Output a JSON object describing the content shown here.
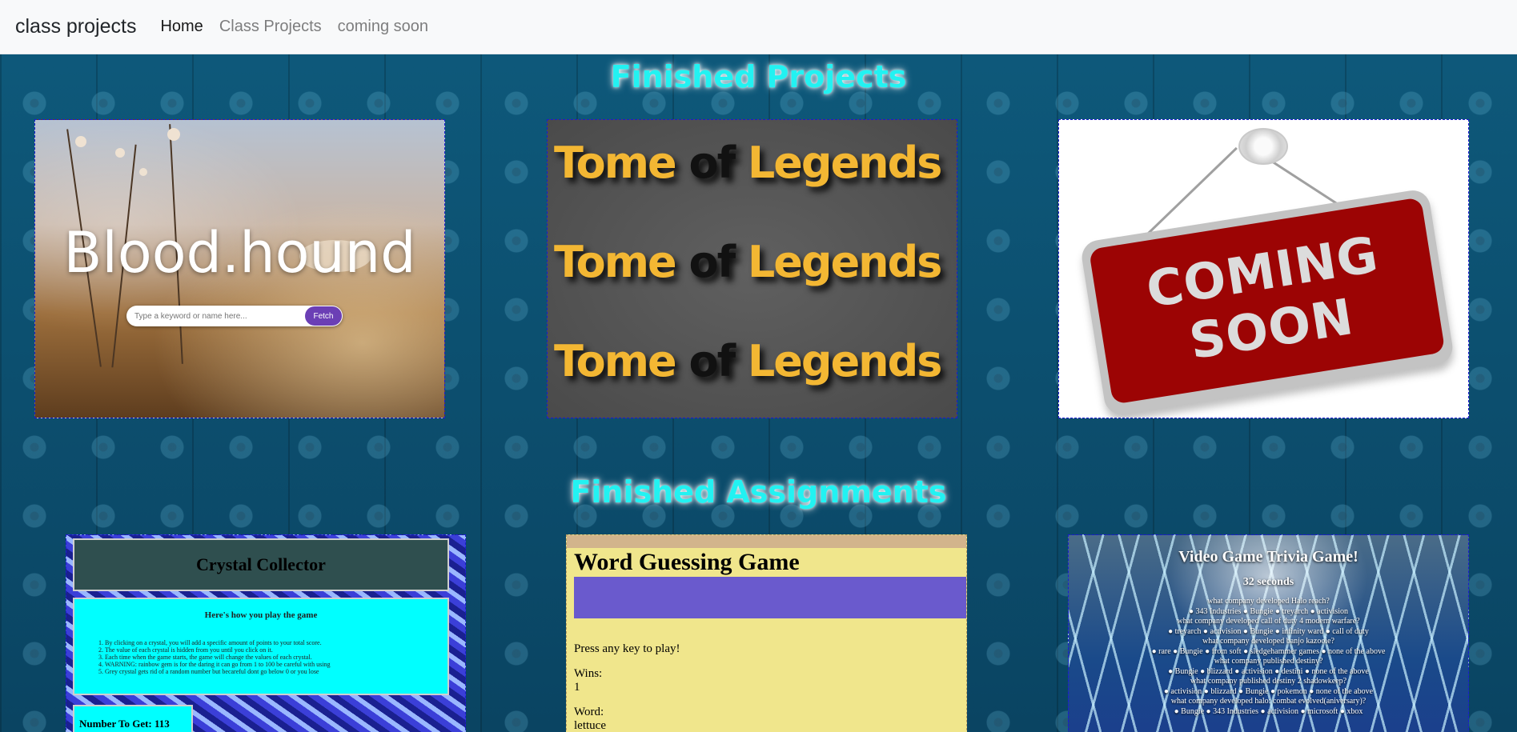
{
  "nav": {
    "brand": "class projects",
    "links": [
      {
        "label": "Home",
        "active": true
      },
      {
        "label": "Class Projects",
        "active": false
      },
      {
        "label": "coming soon",
        "active": false
      }
    ]
  },
  "projects": {
    "title": "Finished Projects",
    "bloodhound": {
      "title": "Blood.hound",
      "search_placeholder": "Type a keyword or name here...",
      "fetch_label": "Fetch"
    },
    "tome": {
      "lines": [
        [
          "Tome",
          "of",
          "Legends"
        ],
        [
          "Tome",
          "of",
          "Legends"
        ],
        [
          "Tome",
          "of",
          "Legends"
        ]
      ]
    },
    "coming_soon": {
      "line1": "COMING",
      "line2": "SOON"
    }
  },
  "assignments": {
    "title": "Finished Assignments",
    "crystal": {
      "title": "Crystal Collector",
      "instructions_heading": "Here's how you play the game",
      "steps": [
        "By clicking on a crystal, you will add a specific amount of points to your total score.",
        "The value of each crystal is hidden from you until you click on it.",
        "Each time when the game starts, the game will change the values of each crystal.",
        "WARNING: rainbow gem is for the daring it can go from 1 to 100 be careful with using",
        "Grey crystal gets rid of a random number but becareful dont go below 0 or you lose"
      ],
      "number_label": "Number To Get: 113"
    },
    "word": {
      "title": "Word Guessing Game",
      "prompt": "Press any key to play!",
      "wins_label": "Wins:",
      "wins_value": "1",
      "word_label": "Word:",
      "word_value": "lettuce"
    },
    "trivia": {
      "title": "Video Game Trivia Game!",
      "timer": "32 seconds",
      "lines": [
        "what company developed Halo reach?",
        "● 343 Industries ● Bungie ● treyarch ● activision",
        "what company developed call of duty 4 modern warfare?",
        "● treyarch ● activision ● Bungie ● infinity ward ● call of duty",
        "what company developed banjo kazooie?",
        "● rare ● Bungie ● from soft ● sledgehammer games ● none of the above",
        "what company published destiny?",
        "● Bungie ● blizzard ● activision ● destini ● none of the above",
        "what company published destiny 2 shadowkeep?",
        "● activision ● blizzard ● Bungie ● pokemon ● none of the above",
        "what company developed halo: combat evolved(aniversary)?",
        "● Bungie ● 343 Industries ● activision ● microsoft ● xbox"
      ]
    }
  }
}
